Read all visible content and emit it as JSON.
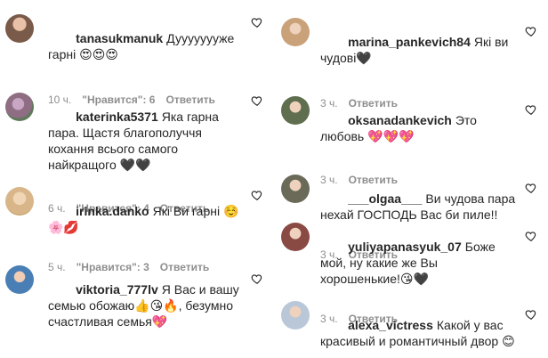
{
  "left": [
    {
      "user": "tanasukmanuk",
      "text": "Дуууууууже гарні 😍😍😍",
      "time": "10 ч.",
      "likes": "\"Нравится\": 6",
      "reply": "Ответить",
      "avatar_color": "#7a5a48"
    },
    {
      "user": "katerinka5371",
      "text": "Яка гарна пара. Щастя благополуччя кохання всього самого найкращого 🖤🖤",
      "time": "6 ч.",
      "likes": "\"Нравится\": 4",
      "reply": "Ответить",
      "avatar_color": "#9b7fa0"
    },
    {
      "user": "irinka.danko",
      "text": "Які Ви гарні ☺️🌸💋",
      "time": "5 ч.",
      "likes": "\"Нравится\": 3",
      "reply": "Ответить",
      "avatar_color": "#d8b68a"
    },
    {
      "user": "viktoria_777lv",
      "text": "Я Вас и вашу семью обожаю👍😘🔥, безумно счастливая семья💖",
      "time": "",
      "likes": "",
      "reply": "",
      "avatar_color": "#4a7fb5"
    }
  ],
  "right": [
    {
      "user": "marina_pankevich84",
      "text": "Які ви чудові🖤",
      "time": "3 ч.",
      "reply": "Ответить",
      "avatar_color": "#c9a27a"
    },
    {
      "user": "oksanadankevich",
      "text": "Это любовь 💖💖💖",
      "time": "3 ч.",
      "reply": "Ответить",
      "avatar_color": "#5e6e4e"
    },
    {
      "user": "___olgaa___",
      "text": "Ви чудова пара нехай ГОСПОДЬ Вас би пиле!!",
      "time": "3 ч.",
      "reply": "Ответить",
      "avatar_color": "#6b6a58"
    },
    {
      "user": "yuliyapanasyuk_07",
      "text": "Боже мой, ну какие же Вы хорошенькие!😘🖤",
      "time": "3 ч.",
      "reply": "Ответить",
      "avatar_color": "#8a4a44"
    },
    {
      "user": "alexa_victress",
      "text": "Какой у вас красивый и романтичный двор 😊",
      "time": "",
      "reply": "",
      "avatar_color": "#b9c7d8"
    }
  ]
}
